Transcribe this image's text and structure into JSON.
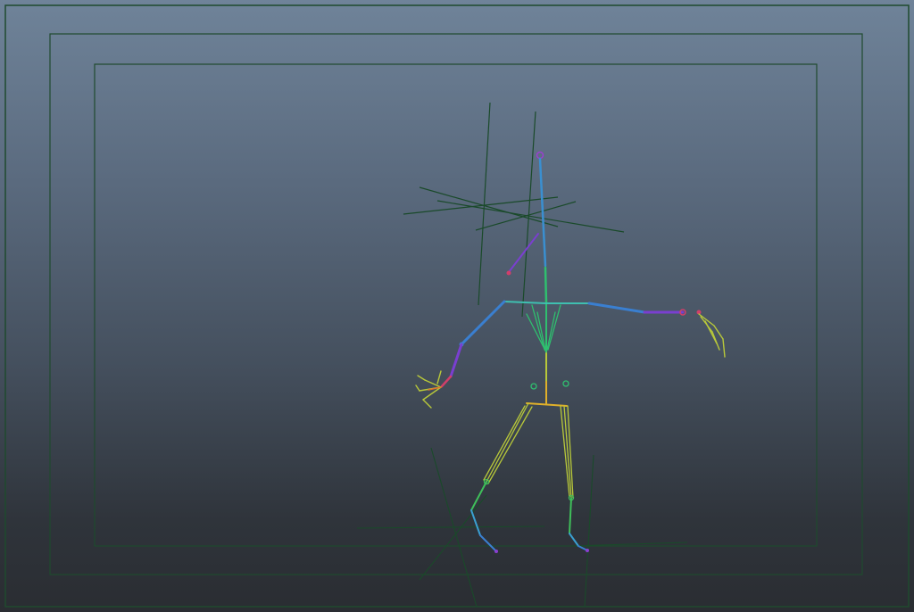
{
  "viewport": {
    "panel": "3d-perspective-viewport",
    "background_top": "#6f8399",
    "background_bottom": "#2a2d32",
    "frame_guide_color": "#1f4a2e",
    "locator_color": "#1a4a2a"
  },
  "scene": {
    "object": "skeleton-rig",
    "joint_colors": {
      "spine": "#2fbf6f",
      "neck": "#3a8fd0",
      "head_end": "#9a3fd0",
      "clavicle": "#3fbfb0",
      "upper_arm": "#3a7fd0",
      "forearm": "#7a3fd0",
      "hand": "#d03f6a",
      "fingers": "#b8c83a",
      "hips": "#e0b02a",
      "thigh": "#b8c83a",
      "shin": "#3fbf5a",
      "foot": "#3a9fd0",
      "toe": "#8a3fd0"
    }
  }
}
